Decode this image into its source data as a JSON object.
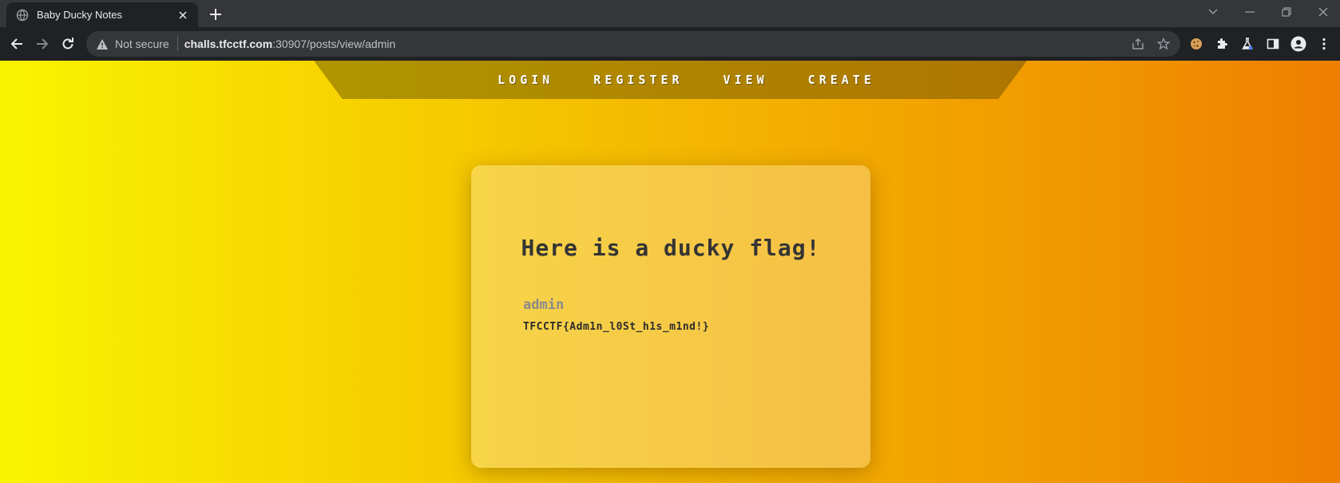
{
  "browser": {
    "tab": {
      "title": "Baby Ducky Notes"
    },
    "address_bar": {
      "security_label": "Not secure",
      "url_host": "challs.tfcctf.com",
      "url_path": ":30907/posts/view/admin"
    }
  },
  "page": {
    "nav": {
      "links": [
        "LOGIN",
        "REGISTER",
        "VIEW",
        "CREATE"
      ]
    },
    "post": {
      "title": "Here is a ducky flag!",
      "author": "admin",
      "content": "TFCCTF{Adm1n_l0St_h1s_m1nd!}"
    }
  },
  "colors": {
    "chrome_dark": "#202124",
    "tabstrip": "#35363a",
    "gradient_left": "#f9f400",
    "gradient_right": "#ee7f00",
    "card": "#f7d448",
    "title_text": "#343434",
    "author_text": "#8a8a8a"
  }
}
